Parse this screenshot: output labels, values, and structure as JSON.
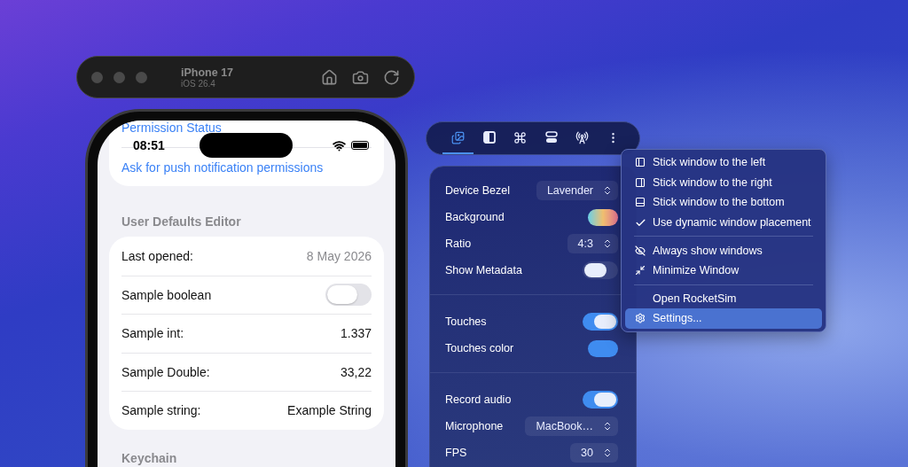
{
  "simulator": {
    "title": "iPhone 17",
    "subtitle": "iOS 26.4"
  },
  "phone": {
    "status_bar": {
      "time": "08:51"
    },
    "top_card": {
      "link": "Permission Status",
      "action": "Ask for push notification permissions"
    },
    "sections": [
      {
        "header": "User Defaults Editor",
        "rows": [
          {
            "kind": "value",
            "label": "Last opened:",
            "value": "8 May 2026",
            "muted": true
          },
          {
            "kind": "toggle",
            "label": "Sample boolean",
            "on": false
          },
          {
            "kind": "value",
            "label": "Sample int:",
            "value": "1.337",
            "muted": false
          },
          {
            "kind": "value",
            "label": "Sample Double:",
            "value": "33,22",
            "muted": false
          },
          {
            "kind": "value",
            "label": "Sample string:",
            "value": "Example String",
            "muted": false
          }
        ]
      },
      {
        "header": "Keychain"
      }
    ]
  },
  "toolbar": {
    "tabs": [
      {
        "selected": true
      },
      {
        "selected": false
      },
      {
        "selected": false
      },
      {
        "selected": false
      },
      {
        "selected": false
      },
      {
        "selected": false
      }
    ]
  },
  "panel": {
    "groups": [
      [
        {
          "kind": "select",
          "label": "Device Bezel",
          "value": "Lavender"
        },
        {
          "kind": "gradient",
          "label": "Background"
        },
        {
          "kind": "select",
          "label": "Ratio",
          "value": "4:3"
        },
        {
          "kind": "toggle",
          "label": "Show Metadata",
          "on": false
        }
      ],
      [
        {
          "kind": "toggle",
          "label": "Touches",
          "on": true
        },
        {
          "kind": "color",
          "label": "Touches color",
          "color": "#3f8cf0"
        }
      ],
      [
        {
          "kind": "toggle",
          "label": "Record audio",
          "on": true
        },
        {
          "kind": "select",
          "label": "Microphone",
          "value": "MacBook…"
        },
        {
          "kind": "select",
          "label": "FPS",
          "value": "30"
        }
      ]
    ]
  },
  "menu": {
    "groups": [
      [
        {
          "label": "Stick window to the left",
          "checked": false,
          "selected": false
        },
        {
          "label": "Stick window to the right",
          "checked": false,
          "selected": false
        },
        {
          "label": "Stick window to the bottom",
          "checked": false,
          "selected": false
        },
        {
          "label": "Use dynamic window placement",
          "checked": true,
          "selected": false
        }
      ],
      [
        {
          "label": "Always show windows",
          "checked": false,
          "selected": false
        },
        {
          "label": "Minimize Window",
          "checked": false,
          "selected": false
        }
      ],
      [
        {
          "label": "Open RocketSim",
          "checked": false,
          "selected": false
        },
        {
          "label": "Settings...",
          "checked": false,
          "selected": true
        }
      ]
    ]
  }
}
